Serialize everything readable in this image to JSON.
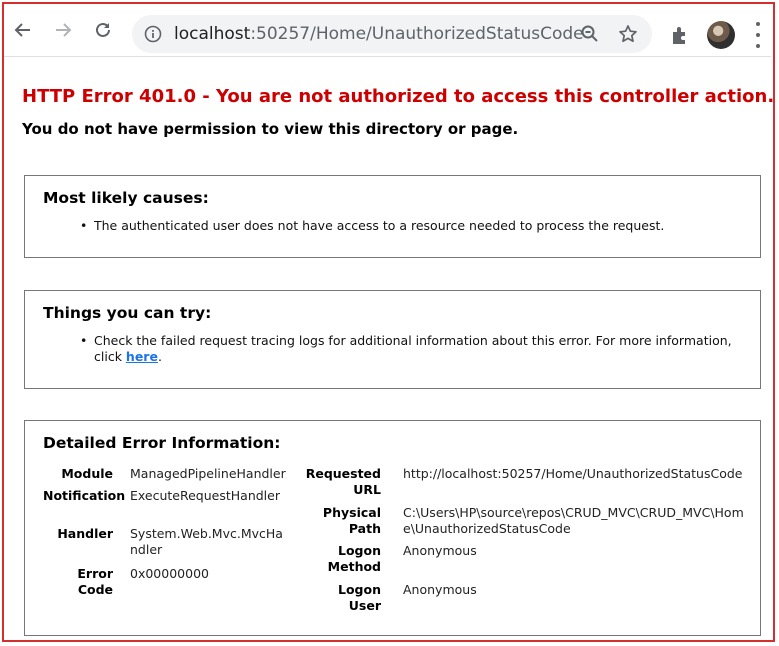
{
  "browser": {
    "url_host": "localhost",
    "url_path": ":50257/Home/UnauthorizedStatusCode",
    "icons": [
      "back-icon",
      "forward-icon",
      "reload-icon",
      "info-icon",
      "zoom-icon",
      "star-icon",
      "extensions-icon",
      "profile-avatar",
      "more-menu-icon"
    ]
  },
  "page": {
    "title": "HTTP Error 401.0 - You are not authorized to access this controller action.",
    "subtitle": "You do not have permission to view this directory or page.",
    "causes": {
      "heading": "Most likely causes:",
      "items": [
        "The authenticated user does not have access to a resource needed to process the request."
      ]
    },
    "try": {
      "heading": "Things you can try:",
      "item_prefix": "Check the failed request tracing logs for additional information about this error. For more information,",
      "item_click": "click",
      "link": "here",
      "item_suffix": "."
    },
    "details": {
      "heading": "Detailed Error Information:",
      "left": [
        {
          "key": "Module",
          "value": "ManagedPipelineHandler"
        },
        {
          "key": "Notification",
          "value": "ExecuteRequestHandler"
        },
        {
          "key": "Handler",
          "value": "System.Web.Mvc.MvcHandler"
        },
        {
          "key": "Error Code",
          "value": "0x00000000"
        }
      ],
      "right": [
        {
          "key": "Requested URL",
          "value": "http://localhost:50257/Home/UnauthorizedStatusCode"
        },
        {
          "key": "Physical Path",
          "value": "C:\\Users\\HP\\source\\repos\\CRUD_MVC\\CRUD_MVC\\Home\\UnauthorizedStatusCode"
        },
        {
          "key": "Logon Method",
          "value": "Anonymous"
        },
        {
          "key": "Logon User",
          "value": "Anonymous"
        }
      ]
    }
  },
  "colors": {
    "frame": "#d32f2f",
    "error_title": "#cc0000",
    "link": "#1a73e8"
  }
}
